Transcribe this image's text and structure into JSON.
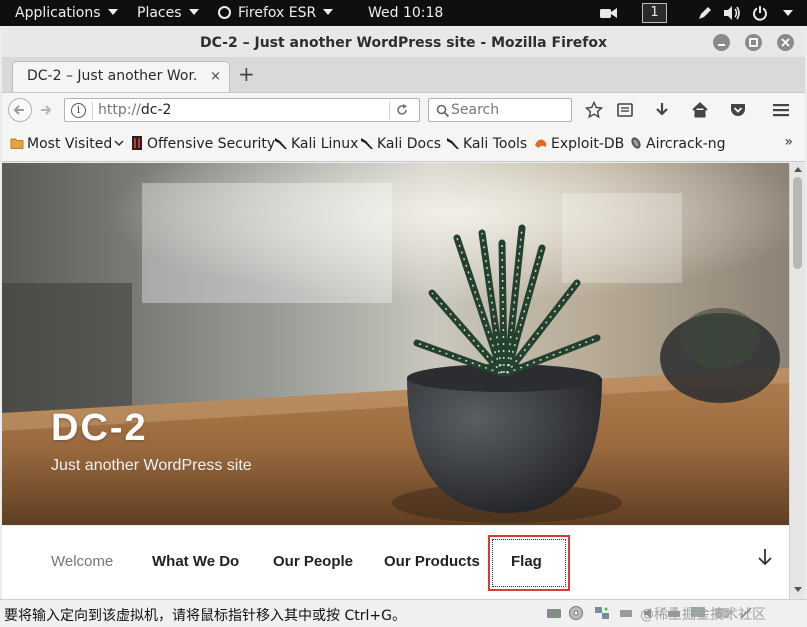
{
  "desktop": {
    "applications_label": "Applications",
    "places_label": "Places",
    "firefox_label": "Firefox ESR",
    "clock": "Wed 10:18",
    "workspace_number": "1"
  },
  "window": {
    "title": "DC-2 – Just another WordPress site - Mozilla Firefox"
  },
  "tabs": [
    {
      "label": "DC-2 – Just another Wor...",
      "close_glyph": "×"
    }
  ],
  "new_tab_glyph": "+",
  "navbar": {
    "url_protocol": "http://",
    "url_host": "dc-2",
    "search_placeholder": "Search"
  },
  "bookmarks": {
    "items": [
      {
        "label": "Most Visited",
        "icon": "folder-icon",
        "has_caret": true
      },
      {
        "label": "Offensive Security",
        "icon": "offsec-icon"
      },
      {
        "label": "Kali Linux",
        "icon": "kali-dragon-icon"
      },
      {
        "label": "Kali Docs",
        "icon": "kali-dragon-icon"
      },
      {
        "label": "Kali Tools",
        "icon": "kali-dragon-icon"
      },
      {
        "label": "Exploit-DB",
        "icon": "exploit-db-icon"
      },
      {
        "label": "Aircrack-ng",
        "icon": "aircrack-icon"
      }
    ],
    "overflow_glyph": "»"
  },
  "site": {
    "title": "DC-2",
    "tagline": "Just another WordPress site"
  },
  "menu": {
    "items": [
      {
        "label": "Welcome",
        "current": true
      },
      {
        "label": "What We Do"
      },
      {
        "label": "Our People"
      },
      {
        "label": "Our Products"
      },
      {
        "label": "Flag"
      }
    ]
  },
  "statusbar": {
    "text": "要将输入定向到该虚拟机，请将鼠标指针移入其中或按 Ctrl+G。",
    "watermark": "@稀土掘金技术社区"
  },
  "colors": {
    "flag_highlight": "#d93a3a",
    "topbar_bg": "#0f0f0f"
  }
}
